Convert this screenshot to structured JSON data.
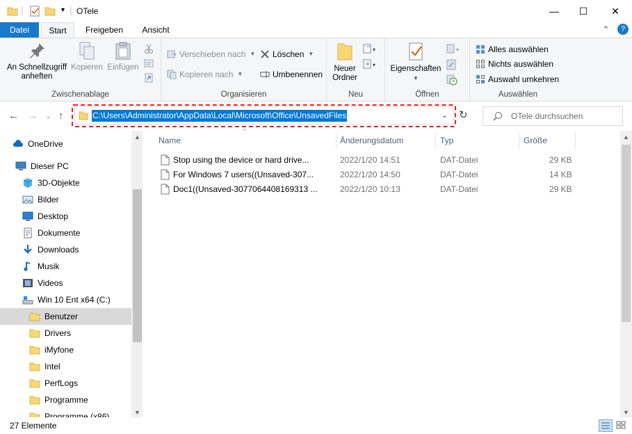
{
  "window": {
    "title": "OTele",
    "minimize": "—",
    "maximize": "☐",
    "close": "✕"
  },
  "ribbon_tabs": {
    "file": "Datei",
    "start": "Start",
    "share": "Freigeben",
    "view": "Ansicht",
    "expand": "⌃",
    "help": "?"
  },
  "clipboard": {
    "pin_line1": "An Schnellzugriff",
    "pin_line2": "anheften",
    "copy": "Kopieren",
    "paste": "Einfügen",
    "label": "Zwischenablage"
  },
  "organize": {
    "move_to": "Verschieben nach",
    "copy_to": "Kopieren nach",
    "delete": "Löschen",
    "rename": "Umbenennen",
    "label": "Organisieren"
  },
  "new": {
    "new_folder_line1": "Neuer",
    "new_folder_line2": "Ordner",
    "label": "Neu"
  },
  "open": {
    "properties": "Eigenschaften",
    "label": "Öffnen"
  },
  "select": {
    "select_all": "Alles auswählen",
    "select_none": "Nichts auswählen",
    "invert": "Auswahl umkehren",
    "label": "Auswählen"
  },
  "address": {
    "path": "C:\\Users\\Administrator\\AppData\\Local\\Microsoft\\Office\\UnsavedFiles"
  },
  "search": {
    "placeholder": "OTele durchsuchen"
  },
  "nav": [
    {
      "label": "OneDrive",
      "icon": "cloud-icon"
    },
    {
      "label": "Dieser PC",
      "icon": "pc-icon"
    },
    {
      "label": "3D-Objekte",
      "icon": "cube-icon"
    },
    {
      "label": "Bilder",
      "icon": "pictures-icon"
    },
    {
      "label": "Desktop",
      "icon": "desktop-icon"
    },
    {
      "label": "Dokumente",
      "icon": "documents-icon"
    },
    {
      "label": "Downloads",
      "icon": "download-icon"
    },
    {
      "label": "Musik",
      "icon": "music-icon"
    },
    {
      "label": "Videos",
      "icon": "video-icon"
    },
    {
      "label": "Win 10 Ent x64 (C:)",
      "icon": "drive-icon"
    },
    {
      "label": "Benutzer",
      "icon": "folder-icon"
    },
    {
      "label": "Drivers",
      "icon": "folder-icon"
    },
    {
      "label": "iMyfone",
      "icon": "folder-icon"
    },
    {
      "label": "Intel",
      "icon": "folder-icon"
    },
    {
      "label": "PerfLogs",
      "icon": "folder-icon"
    },
    {
      "label": "Programme",
      "icon": "folder-icon"
    },
    {
      "label": "Programme (x86)",
      "icon": "folder-icon"
    }
  ],
  "columns": {
    "name": "Name",
    "date": "Änderungsdatum",
    "type": "Typ",
    "size": "Größe"
  },
  "files": [
    {
      "name": "Stop using the device or hard drive...",
      "date": "2022/1/20 14:51",
      "type": "DAT-Datei",
      "size": "29 KB"
    },
    {
      "name": "For Windows 7 users((Unsaved-307...",
      "date": "2022/1/20 14:50",
      "type": "DAT-Datei",
      "size": "14 KB"
    },
    {
      "name": "Doc1((Unsaved-3077064408169313 ...",
      "date": "2022/1/20 10:13",
      "type": "DAT-Datei",
      "size": "29 KB"
    }
  ],
  "status": {
    "count": "27 Elemente"
  },
  "colors": {
    "accent": "#1979ca",
    "selection": "#0078d7",
    "highlight": "#e02020",
    "folder": "#f8d775"
  }
}
